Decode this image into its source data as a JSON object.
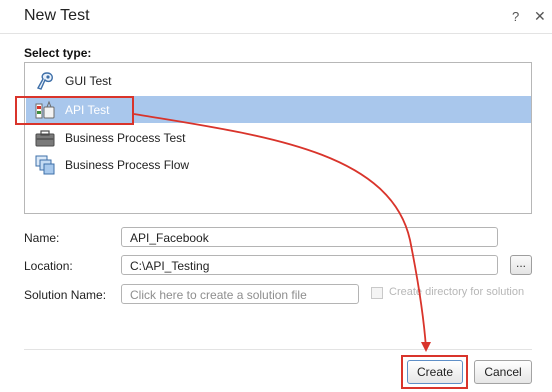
{
  "dialog": {
    "title": "New Test",
    "help_glyph": "?",
    "close_glyph": "✕"
  },
  "type_section": {
    "label": "Select type:",
    "items": [
      {
        "label": "GUI Test",
        "icon": "gui-test-icon",
        "selected": false
      },
      {
        "label": "API Test",
        "icon": "api-test-icon",
        "selected": true
      },
      {
        "label": "Business Process Test",
        "icon": "business-process-test-icon",
        "selected": false
      },
      {
        "label": "Business Process Flow",
        "icon": "business-process-flow-icon",
        "selected": false
      }
    ]
  },
  "form": {
    "name_label": "Name:",
    "name_value": "API_Facebook",
    "location_label": "Location:",
    "location_value": "C:\\API_Testing",
    "browse_label": "...",
    "solution_label": "Solution Name:",
    "solution_placeholder": "Click here to create a solution file",
    "create_dir_label": "Create directory for solution"
  },
  "buttons": {
    "create": "Create",
    "cancel": "Cancel"
  },
  "colors": {
    "selection": "#a9c7ec",
    "annotation": "#d9342b"
  }
}
